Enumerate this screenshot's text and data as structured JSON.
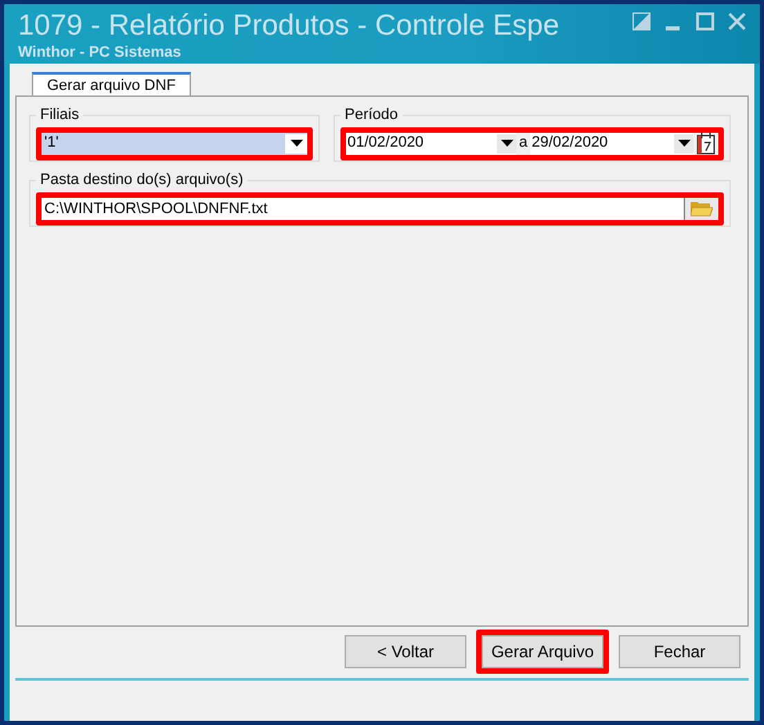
{
  "window": {
    "title": "1079 - Relatório Produtos - Controle Espe",
    "subtitle": "Winthor - PC Sistemas"
  },
  "tabs": [
    {
      "label": "Gerar arquivo DNF",
      "selected": true
    }
  ],
  "filiais": {
    "label": "Filiais",
    "value": "'1'",
    "highlighted": true
  },
  "periodo": {
    "label": "Período",
    "from": "01/02/2020",
    "separator": "a",
    "to": "29/02/2020",
    "highlighted": true
  },
  "pasta": {
    "label": "Pasta destino do(s) arquivo(s)",
    "value": "C:\\WINTHOR\\SPOOL\\DNFNF.txt",
    "highlighted": true
  },
  "buttons": [
    {
      "label": "< Voltar",
      "highlighted": false
    },
    {
      "label": "Gerar Arquivo",
      "highlighted": true
    },
    {
      "label": "Fechar",
      "highlighted": false
    }
  ]
}
